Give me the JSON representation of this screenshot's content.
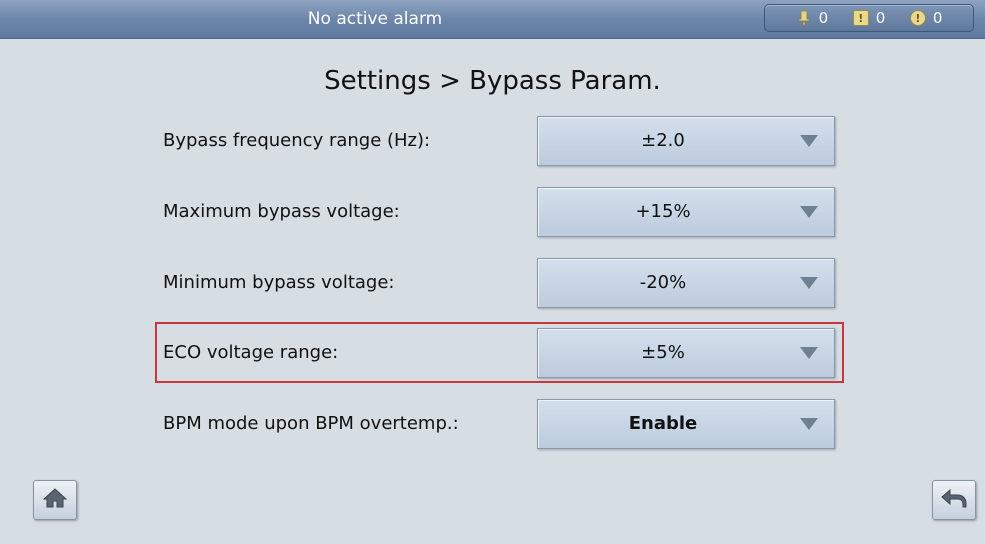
{
  "header": {
    "alarm_status": "No active alarm",
    "counters": [
      {
        "icon": "critical-alarm-icon",
        "count": "0"
      },
      {
        "icon": "major-alarm-icon",
        "count": "0"
      },
      {
        "icon": "minor-alarm-icon",
        "count": "0"
      }
    ]
  },
  "page": {
    "title": "Settings > Bypass Param."
  },
  "settings": [
    {
      "label": "Bypass frequency range (Hz):",
      "value": "±2.0"
    },
    {
      "label": "Maximum bypass voltage:",
      "value": "+15%"
    },
    {
      "label": "Minimum bypass voltage:",
      "value": "-20%"
    },
    {
      "label": "ECO voltage range:",
      "value": "±5%",
      "highlighted": true
    },
    {
      "label": "BPM mode upon BPM overtemp.:",
      "value": "Enable"
    }
  ],
  "footer": {
    "home_icon": "home-icon",
    "back_icon": "back-arrow-icon"
  },
  "colors": {
    "topbar": "#6d87ab",
    "background": "#d6dde3",
    "dropdown": "#c8d5e5",
    "highlight": "#c8373f"
  }
}
